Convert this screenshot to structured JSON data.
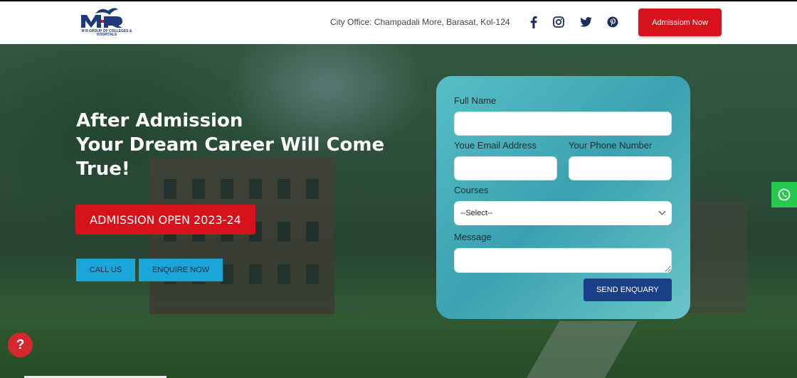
{
  "header": {
    "logo_text": "M R GROUP OF COLLEGES & HOSPITALS",
    "office": "City Office: Champadali More, Barasat, Kol-124",
    "social": [
      {
        "icon": "facebook-icon",
        "glyph": "f"
      },
      {
        "icon": "instagram-icon",
        "glyph": ""
      },
      {
        "icon": "twitter-icon",
        "glyph": ""
      },
      {
        "icon": "pinterest-icon",
        "glyph": ""
      }
    ],
    "admission_button": "Admissiom Now"
  },
  "hero": {
    "headline_line1": "After Admission",
    "headline_line2": "Your Dream Career Will Come",
    "headline_line3": "True!",
    "badge": "ADMISSION OPEN 2023-24",
    "call_button": "CALL US",
    "enquire_button": "ENQUIRE NOW"
  },
  "form": {
    "full_name_label": "Full Name",
    "email_label": "Youe Email Address",
    "phone_label": "Your Phone Number",
    "courses_label": "Courses",
    "courses_selected": "--Select--",
    "message_label": "Message",
    "send_button": "SEND ENQUARY"
  },
  "floating": {
    "help_glyph": "?"
  },
  "colors": {
    "brand_red": "#d8121c",
    "brand_navy": "#1b3f86",
    "cyan": "#1aa6d8",
    "whatsapp_green": "#25c94b"
  }
}
